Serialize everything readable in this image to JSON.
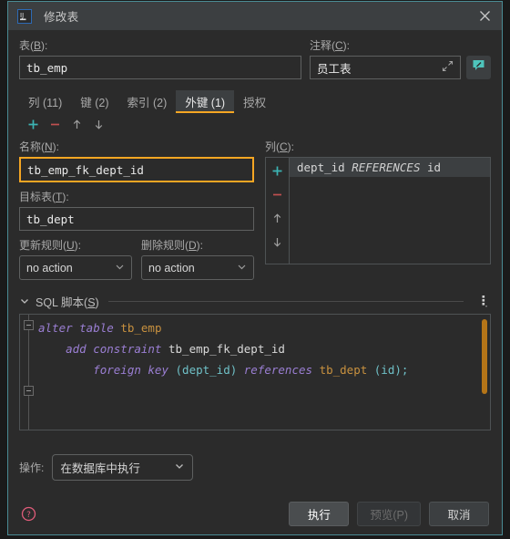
{
  "window": {
    "title": "修改表",
    "app_icon": "intellij-idea-icon",
    "close_icon": "close-icon",
    "border_color": "#4a8b94",
    "titlebar_bg": "#3c3f41"
  },
  "table_field": {
    "label": "表(B):",
    "label_plain": "表(",
    "mnemonic": "B",
    "label_suffix": "):",
    "value": "tb_emp"
  },
  "comment_field": {
    "label_plain": "注释(",
    "mnemonic": "C",
    "label_suffix": "):",
    "value": "员工表",
    "expand_icon": "expand-icon",
    "comment_button_icon": "comment-edit-icon",
    "comment_button_color": "#4ec4bc"
  },
  "tabs": {
    "items": [
      {
        "label": "列 (11)",
        "active": false
      },
      {
        "label": "键 (2)",
        "active": false
      },
      {
        "label": "索引 (2)",
        "active": false
      },
      {
        "label": "外键 (1)",
        "active": true
      },
      {
        "label": "授权",
        "active": false
      }
    ],
    "active_underline_color": "#f5a623"
  },
  "toolbar": {
    "add_icon": "plus-icon",
    "remove_icon": "minus-icon",
    "up_icon": "arrow-up-icon",
    "down_icon": "arrow-down-icon",
    "add_color": "#3cb4b4",
    "remove_color": "#c05050"
  },
  "form": {
    "name": {
      "label_plain": "名称(",
      "mnemonic": "N",
      "label_suffix": "):",
      "value": "tb_emp_fk_dept_id",
      "focus_color": "#f5a623"
    },
    "target_table": {
      "label_plain": "目标表(",
      "mnemonic": "T",
      "label_suffix": "):",
      "value": "tb_dept"
    },
    "update_rule": {
      "label_plain": "更新规则(",
      "mnemonic": "U",
      "label_suffix": "):",
      "value": "no action"
    },
    "delete_rule": {
      "label_plain": "删除规则(",
      "mnemonic": "D",
      "label_suffix": "):",
      "value": "no action"
    }
  },
  "columns_panel": {
    "label_plain": "列(",
    "mnemonic": "C",
    "label_suffix": "):",
    "items": [
      {
        "name": "dept_id",
        "keyword": "REFERENCES",
        "target": "id",
        "selected": true
      }
    ]
  },
  "sql_section": {
    "title": "SQL 脚本(",
    "mnemonic": "S",
    "title_suffix": ")",
    "collapse_icon": "chevron-down-icon",
    "more_icon": "more-options-icon",
    "scrollbar_color": "#b57518",
    "code_lines": [
      [
        {
          "t": "alter table ",
          "c": "kw"
        },
        {
          "t": "tb_emp",
          "c": "idn"
        }
      ],
      [
        {
          "t": "    add constraint ",
          "c": "kw"
        },
        {
          "t": "tb_emp_fk_dept_id",
          "c": "pln"
        }
      ],
      [
        {
          "t": "        foreign key ",
          "c": "kw"
        },
        {
          "t": "(dept_id)",
          "c": "pun"
        },
        {
          "t": " references ",
          "c": "kw"
        },
        {
          "t": "tb_dept ",
          "c": "idn"
        },
        {
          "t": "(id);",
          "c": "pun"
        }
      ]
    ]
  },
  "operation": {
    "label": "操作:",
    "value": "在数据库中执行"
  },
  "footer": {
    "help_icon": "help-icon",
    "help_color": "#e05c7a",
    "buttons": [
      {
        "label": "执行",
        "style": "primary",
        "enabled": true
      },
      {
        "label": "预览(P)",
        "style": "disabled",
        "enabled": false
      },
      {
        "label": "取消",
        "style": "normal",
        "enabled": true
      }
    ]
  }
}
